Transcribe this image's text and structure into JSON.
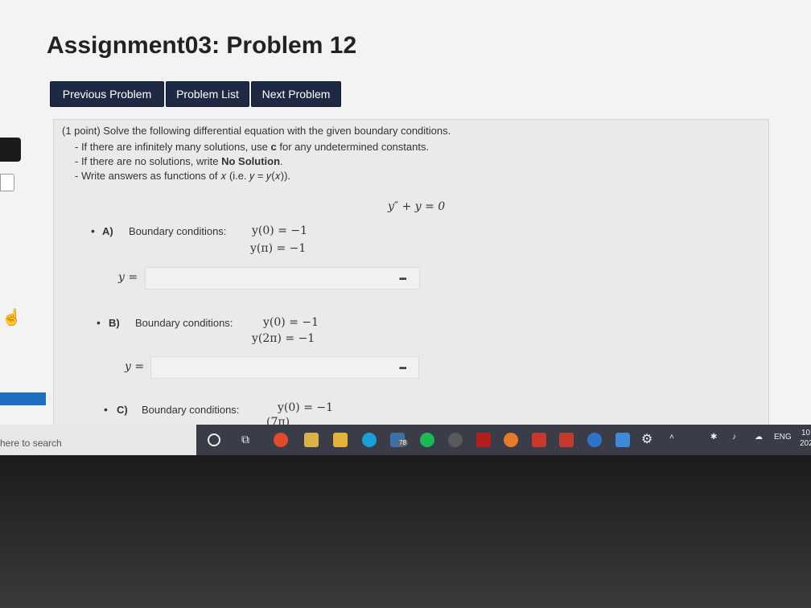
{
  "page": {
    "title": "Assignment03: Problem 12"
  },
  "nav": {
    "previous": "Previous Problem",
    "list": "Problem List",
    "next": "Next Problem"
  },
  "problem": {
    "intro": "(1 point) Solve the following differential equation with the given boundary conditions.",
    "rules": {
      "r1_pre": "- If there are infinitely many solutions, use ",
      "r1_bold": "c",
      "r1_post": " for any undetermined constants.",
      "r2_pre": "- If there are no solutions, write ",
      "r2_bold": "No Solution",
      "r2_post": ".",
      "r3": "- Write answers as functions of 𝑥 (i.e. 𝑦 = 𝑦(𝑥))."
    },
    "equation": "y″ + y = 0",
    "parts": [
      {
        "label": "A)",
        "bc_label": "Boundary conditions:",
        "bc1": "y(0) = −1",
        "bc2": "y(π) = −1",
        "answer_label": "y =",
        "answer_value": ""
      },
      {
        "label": "B)",
        "bc_label": "Boundary conditions:",
        "bc1": "y(0) = −1",
        "bc2": "y(2π) = −1",
        "answer_label": "y =",
        "answer_value": ""
      },
      {
        "label": "C)",
        "bc_label": "Boundary conditions:",
        "bc1": "y(0) = −1",
        "bc2": "(7π)",
        "answer_label": "",
        "answer_value": ""
      }
    ]
  },
  "taskbar": {
    "search_placeholder": "here to search",
    "badge_count": "78",
    "language": "ENG",
    "clock_top": "10",
    "clock_bottom": "202"
  },
  "colors": {
    "nav_button": "#1e2a44",
    "problem_bg": "#eaeaea",
    "taskbar": "#3a3c48"
  }
}
